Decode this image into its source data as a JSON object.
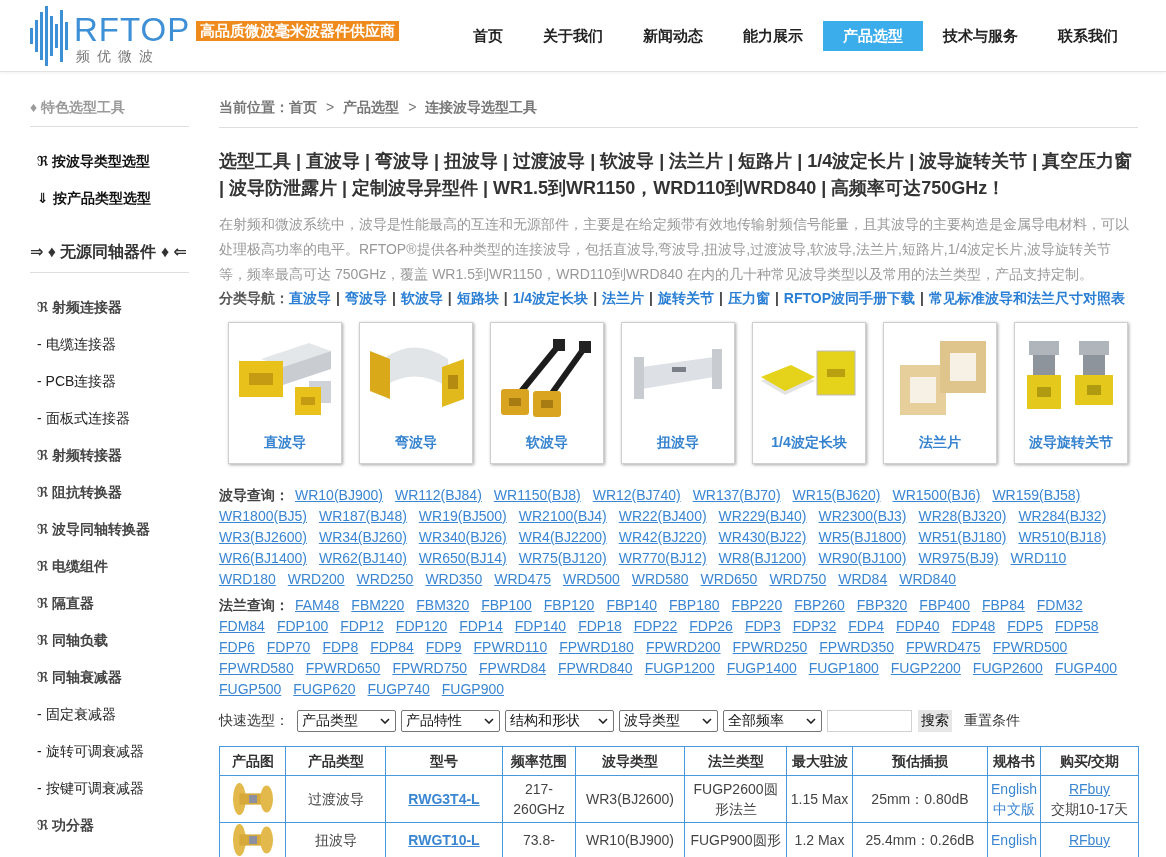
{
  "header": {
    "logo": {
      "brand": "RFTOP",
      "subtitle": "频优微波",
      "slogan": "高品质微波毫米波器件供应商"
    },
    "nav": [
      {
        "label": "首页",
        "selected": false
      },
      {
        "label": "关于我们",
        "selected": false
      },
      {
        "label": "新闻动态",
        "selected": false
      },
      {
        "label": "能力展示",
        "selected": false
      },
      {
        "label": "产品选型",
        "selected": true
      },
      {
        "label": "技术与服务",
        "selected": false
      },
      {
        "label": "联系我们",
        "selected": false
      }
    ]
  },
  "sidebar": {
    "sections": [
      {
        "title": "♦ 特色选型工具",
        "kind": "muted",
        "items": [
          {
            "label": "ℜ 按波导类型选型",
            "kind": "tool"
          },
          {
            "label": "⇓ 按产品类型选型",
            "kind": "tool"
          }
        ]
      },
      {
        "title": "⇒ ♦ 无源同轴器件 ♦ ⇐",
        "kind": "strong",
        "items": [
          {
            "label": "ℜ 射频连接器",
            "kind": "category"
          },
          {
            "label": "- 电缆连接器",
            "kind": "sub"
          },
          {
            "label": "- PCB连接器",
            "kind": "sub"
          },
          {
            "label": "- 面板式连接器",
            "kind": "sub"
          },
          {
            "label": "ℜ 射频转接器",
            "kind": "category"
          },
          {
            "label": "ℜ 阻抗转换器",
            "kind": "category"
          },
          {
            "label": "ℜ 波导同轴转换器",
            "kind": "category"
          },
          {
            "label": "ℜ 电缆组件",
            "kind": "category"
          },
          {
            "label": "ℜ 隔直器",
            "kind": "category"
          },
          {
            "label": "ℜ 同轴负载",
            "kind": "category"
          },
          {
            "label": "ℜ 同轴衰减器",
            "kind": "category"
          },
          {
            "label": "- 固定衰减器",
            "kind": "sub"
          },
          {
            "label": "- 旋转可调衰减器",
            "kind": "sub"
          },
          {
            "label": "- 按键可调衰减器",
            "kind": "sub"
          },
          {
            "label": "ℜ 功分器",
            "kind": "category"
          }
        ]
      }
    ]
  },
  "main": {
    "breadcrumb": {
      "label": "当前位置：",
      "trail": [
        {
          "kind": "link",
          "text": "首页"
        },
        {
          "kind": "separator",
          "text": ">"
        },
        {
          "kind": "link",
          "text": "产品选型"
        },
        {
          "kind": "separator",
          "text": ">"
        },
        {
          "kind": "current",
          "text": "连接波导选型工具"
        }
      ]
    },
    "title": "选型工具 | 直波导 | 弯波导 | 扭波导 | 过渡波导 | 软波导 | 法兰片 | 短路片 | 1/4波定长片 | 波导旋转关节 | 真空压力窗 | 波导防泄露片 | 定制波导异型件 | WR1.5到WR1150，WRD110到WRD840 | 高频率可达750GHz！",
    "description": "在射频和微波系统中，波导是性能最高的互连和无源部件，主要是在给定频带有效地传输射频信号能量，且其波导的主要构造是金属导电材料，可以处理极高功率的电平。RFTOP®提供各种类型的连接波导，包括直波导,弯波导,扭波导,过渡波导,软波导,法兰片,短路片,1/4波定长片,波导旋转关节等，频率最高可达 750GHz，覆盖 WR1.5到WR1150，WRD110到WRD840 在内的几十种常见波导类型以及常用的法兰类型，产品支持定制。",
    "category_nav": {
      "label": "分类导航：",
      "parts": [
        {
          "kind": "link",
          "text": "直波导"
        },
        {
          "kind": "separator",
          "text": "|"
        },
        {
          "kind": "link",
          "text": "弯波导"
        },
        {
          "kind": "separator",
          "text": "|"
        },
        {
          "kind": "link",
          "text": "软波导"
        },
        {
          "kind": "separator",
          "text": "|"
        },
        {
          "kind": "link",
          "text": "短路块"
        },
        {
          "kind": "separator",
          "text": "|"
        },
        {
          "kind": "link",
          "text": "1/4波定长块"
        },
        {
          "kind": "separator",
          "text": "|"
        },
        {
          "kind": "link",
          "text": "法兰片"
        },
        {
          "kind": "separator",
          "text": "|"
        },
        {
          "kind": "link",
          "text": "旋转关节"
        },
        {
          "kind": "separator",
          "text": "|"
        },
        {
          "kind": "link",
          "text": "压力窗"
        },
        {
          "kind": "separator",
          "text": "|"
        },
        {
          "kind": "link",
          "text": "RFTOP波同手册下载"
        },
        {
          "kind": "separator",
          "text": "|"
        },
        {
          "kind": "link",
          "text": "常见标准波导和法兰尺寸对照表"
        }
      ]
    },
    "product_cards": [
      "直波导",
      "弯波导",
      "软波导",
      "扭波导",
      "1/4波定长块",
      "法兰片",
      "波导旋转关节"
    ],
    "waveguide_query": {
      "label": "波导查询：",
      "links": [
        "WR10(BJ900)",
        "WR112(BJ84)",
        "WR1150(BJ8)",
        "WR12(BJ740)",
        "WR137(BJ70)",
        "WR15(BJ620)",
        "WR1500(BJ6)",
        "WR159(BJ58)",
        "WR1800(BJ5)",
        "WR187(BJ48)",
        "WR19(BJ500)",
        "WR2100(BJ4)",
        "WR22(BJ400)",
        "WR229(BJ40)",
        "WR2300(BJ3)",
        "WR28(BJ320)",
        "WR284(BJ32)",
        "WR3(BJ2600)",
        "WR34(BJ260)",
        "WR340(BJ26)",
        "WR4(BJ2200)",
        "WR42(BJ220)",
        "WR430(BJ22)",
        "WR5(BJ1800)",
        "WR51(BJ180)",
        "WR510(BJ18)",
        "WR6(BJ1400)",
        "WR62(BJ140)",
        "WR650(BJ14)",
        "WR75(BJ120)",
        "WR770(BJ12)",
        "WR8(BJ1200)",
        "WR90(BJ100)",
        "WR975(BJ9)",
        "WRD110",
        "WRD180",
        "WRD200",
        "WRD250",
        "WRD350",
        "WRD475",
        "WRD500",
        "WRD580",
        "WRD650",
        "WRD750",
        "WRD84",
        "WRD840"
      ]
    },
    "flange_query": {
      "label": "法兰查询：",
      "links": [
        "FAM48",
        "FBM220",
        "FBM320",
        "FBP100",
        "FBP120",
        "FBP140",
        "FBP180",
        "FBP220",
        "FBP260",
        "FBP320",
        "FBP400",
        "FBP84",
        "FDM32",
        "FDM84",
        "FDP100",
        "FDP12",
        "FDP120",
        "FDP14",
        "FDP140",
        "FDP18",
        "FDP22",
        "FDP26",
        "FDP3",
        "FDP32",
        "FDP4",
        "FDP40",
        "FDP48",
        "FDP5",
        "FDP58",
        "FDP6",
        "FDP70",
        "FDP8",
        "FDP84",
        "FDP9",
        "FPWRD110",
        "FPWRD180",
        "FPWRD200",
        "FPWRD250",
        "FPWRD350",
        "FPWRD475",
        "FPWRD500",
        "FPWRD580",
        "FPWRD650",
        "FPWRD750",
        "FPWRD84",
        "FPWRD840",
        "FUGP1200",
        "FUGP1400",
        "FUGP1800",
        "FUGP2200",
        "FUGP2600",
        "FUGP400",
        "FUGP500",
        "FUGP620",
        "FUGP740",
        "FUGP900"
      ]
    },
    "quick_select": {
      "label": "快速选型：",
      "filters": [
        "产品类型",
        "产品特性",
        "结构和形状",
        "波导类型",
        "全部频率"
      ],
      "search_button": "搜索",
      "reset_link": "重置条件"
    },
    "table": {
      "columns": [
        "产品图",
        "产品类型",
        "型号",
        "频率范围",
        "波导类型",
        "法兰类型",
        "最大驻波",
        "预估插损",
        "规格书",
        "购买/交期"
      ],
      "rows": [
        {
          "product_type": "过渡波导",
          "model": "RWG3T4-L",
          "frequency": "217-260GHz",
          "waveguide_type": "WR3(BJ2600)",
          "flange_type": "FUGP2600圆形法兰",
          "max_vswr": "1.15 Max",
          "insertion_loss": "25mm：0.80dB",
          "datasheets": [
            "English",
            "中文版"
          ],
          "buy_link": "RFbuy",
          "lead_time": "交期10-17天"
        },
        {
          "product_type": "扭波导",
          "model": "RWGT10-L",
          "frequency": "73.8-",
          "waveguide_type": "WR10(BJ900)",
          "flange_type": "FUGP900圆形",
          "max_vswr": "1.2 Max",
          "insertion_loss": "25.4mm：0.26dB",
          "datasheets": [
            "English"
          ],
          "buy_link": "RFbuy"
        }
      ]
    }
  }
}
